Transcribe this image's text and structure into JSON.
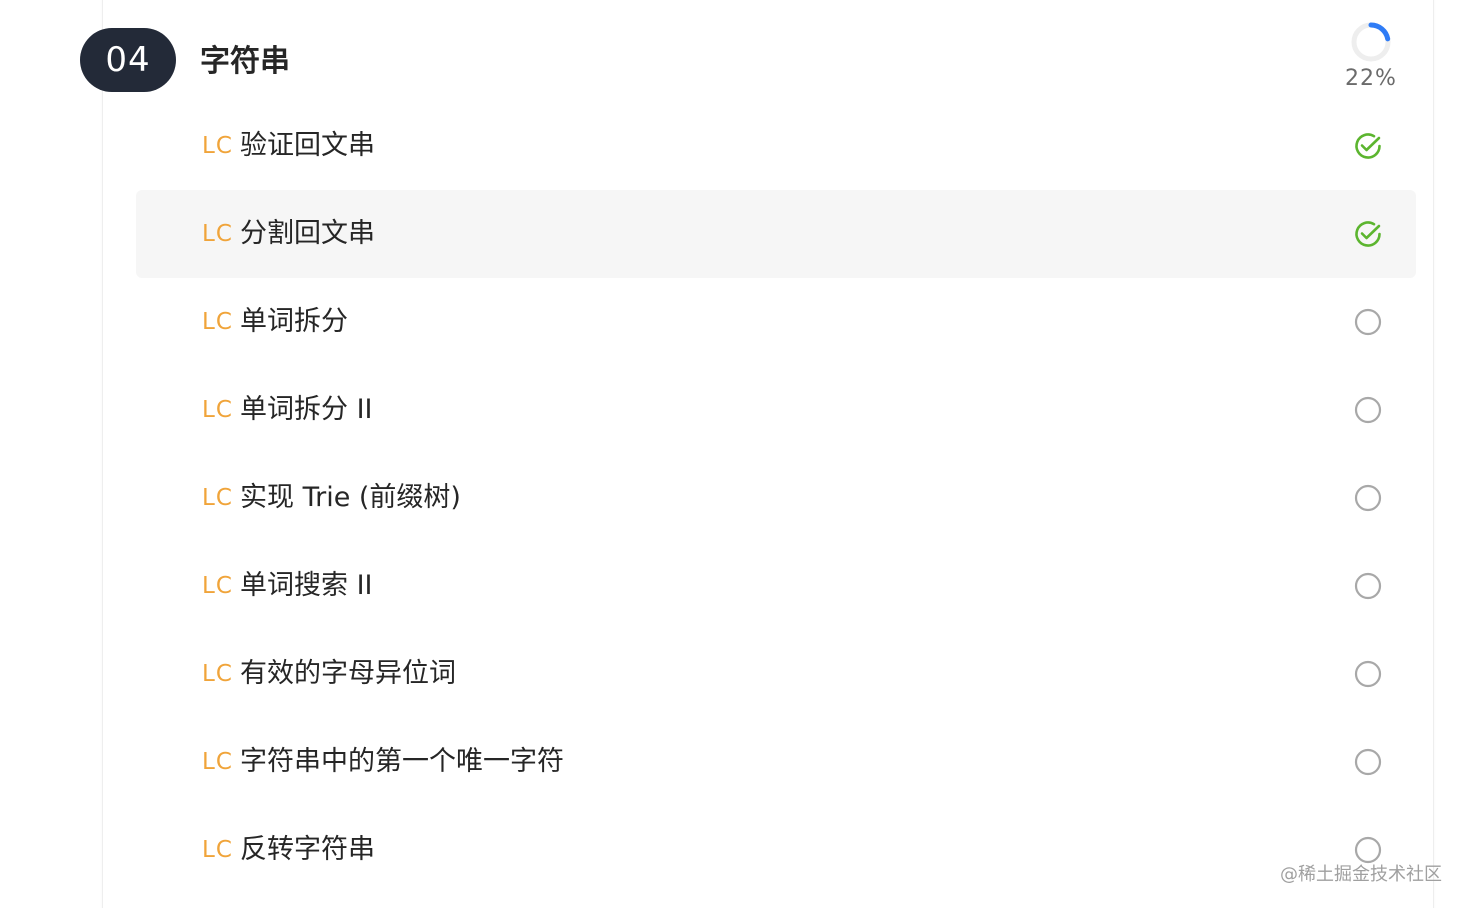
{
  "section": {
    "number": "04",
    "title": "字符串",
    "progress_label": "22%",
    "progress_fraction": 0.22
  },
  "colors": {
    "badge_bg": "#232a38",
    "lc_tag": "#f0a43a",
    "done_check": "#5cb52f",
    "pending_circle": "#a8a8a8",
    "progress_arc": "#2f7cf6",
    "progress_track": "#eeeeee",
    "row_highlight": "#f6f6f6"
  },
  "problems": [
    {
      "tag": "LC",
      "title": "验证回文串",
      "status": "done",
      "status_icon": "check-circle-icon"
    },
    {
      "tag": "LC",
      "title": "分割回文串",
      "status": "done",
      "status_icon": "check-circle-icon",
      "highlighted": true
    },
    {
      "tag": "LC",
      "title": "单词拆分",
      "status": "todo",
      "status_icon": "empty-circle-icon"
    },
    {
      "tag": "LC",
      "title": "单词拆分 II",
      "status": "todo",
      "status_icon": "empty-circle-icon"
    },
    {
      "tag": "LC",
      "title": "实现 Trie (前缀树)",
      "status": "todo",
      "status_icon": "empty-circle-icon"
    },
    {
      "tag": "LC",
      "title": "单词搜索 II",
      "status": "todo",
      "status_icon": "empty-circle-icon"
    },
    {
      "tag": "LC",
      "title": "有效的字母异位词",
      "status": "todo",
      "status_icon": "empty-circle-icon"
    },
    {
      "tag": "LC",
      "title": "字符串中的第一个唯一字符",
      "status": "todo",
      "status_icon": "empty-circle-icon"
    },
    {
      "tag": "LC",
      "title": "反转字符串",
      "status": "todo",
      "status_icon": "empty-circle-icon"
    }
  ],
  "watermark": "@稀土掘金技术社区"
}
